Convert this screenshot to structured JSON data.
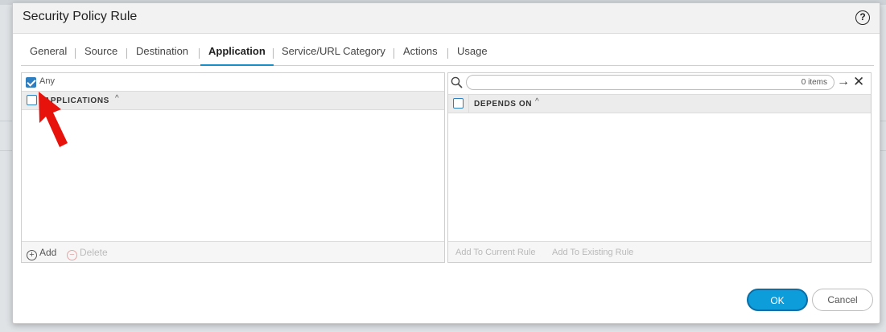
{
  "dialog": {
    "title": "Security Policy Rule",
    "help_icon": "question-circle-icon",
    "help_label": "?"
  },
  "tabs": [
    {
      "label": "General",
      "active": false
    },
    {
      "label": "Source",
      "active": false
    },
    {
      "label": "Destination",
      "active": false
    },
    {
      "label": "Application",
      "active": true
    },
    {
      "label": "Service/URL Category",
      "active": false
    },
    {
      "label": "Actions",
      "active": false
    },
    {
      "label": "Usage",
      "active": false
    }
  ],
  "left_panel": {
    "any_label": "Any",
    "any_checked": true,
    "column_header": "APPLICATIONS",
    "sort_icon": "^",
    "add_label": "Add",
    "add_icon": "+",
    "delete_label": "Delete",
    "delete_icon": "−"
  },
  "right_panel": {
    "items_count": "0 items",
    "search_icon": "search-icon",
    "arrow_icon": "→",
    "close_icon": "✕",
    "column_header": "DEPENDS ON",
    "sort_icon": "^",
    "add_to_current": "Add To Current Rule",
    "add_to_existing": "Add To Existing Rule"
  },
  "buttons": {
    "ok": "OK",
    "cancel": "Cancel"
  },
  "colors": {
    "accent": "#1a8ec7",
    "ok_button": "#0d9ddb",
    "annotation_arrow": "#e8120c"
  }
}
